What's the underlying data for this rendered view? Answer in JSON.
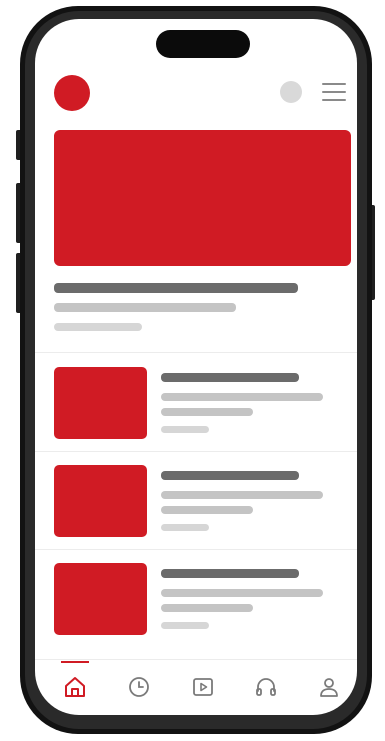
{
  "theme": {
    "accent": "#d01b24",
    "skeleton_dark": "#6b6b6b",
    "skeleton_light": "#c4c4c4",
    "icon_inactive": "#7a7a7a",
    "frame": "#121212"
  },
  "header": {
    "logo_icon": "brand-logo-circle",
    "avatar_icon": "user-avatar-circle",
    "menu_icon": "hamburger-menu-icon"
  },
  "featured": {
    "media_icon": "featured-media-placeholder"
  },
  "feed": {
    "items": [
      {
        "thumbnail_icon": "video-thumbnail-placeholder"
      },
      {
        "thumbnail_icon": "video-thumbnail-placeholder"
      },
      {
        "thumbnail_icon": "video-thumbnail-placeholder"
      }
    ]
  },
  "tabbar": {
    "active_index": 0,
    "tabs": [
      {
        "icon": "home-icon"
      },
      {
        "icon": "clock-icon"
      },
      {
        "icon": "play-icon"
      },
      {
        "icon": "headphones-icon"
      },
      {
        "icon": "profile-icon"
      }
    ]
  }
}
